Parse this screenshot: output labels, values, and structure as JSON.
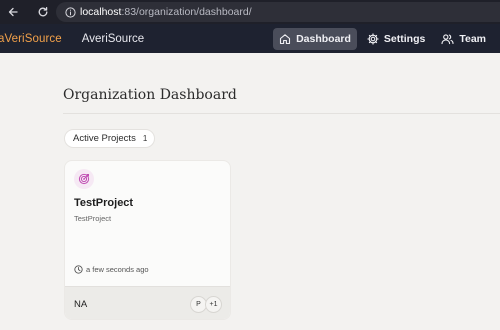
{
  "browser": {
    "url_host": "localhost",
    "url_rest": ":83/organization/dashboard/"
  },
  "header": {
    "brand": "aVeriSource",
    "product": "AveriSource",
    "nav": [
      {
        "label": "Dashboard",
        "icon": "home-icon",
        "active": true
      },
      {
        "label": "Settings",
        "icon": "gear-icon",
        "active": false
      },
      {
        "label": "Team",
        "icon": "users-icon",
        "active": false
      }
    ]
  },
  "main": {
    "title": "Organization Dashboard",
    "filter_pill": {
      "label": "Active Projects",
      "count": "1"
    },
    "projects": [
      {
        "icon": "target-icon",
        "name": "TestProject",
        "description": "TestProject",
        "updated": "a few seconds ago",
        "footer_label": "NA",
        "members": [
          "P",
          "+1"
        ]
      }
    ]
  },
  "colors": {
    "brand_accent": "#f2a14a",
    "header_bg": "#1e2230",
    "page_bg": "#f3f2f0",
    "icon_accent": "#c04fb3"
  }
}
